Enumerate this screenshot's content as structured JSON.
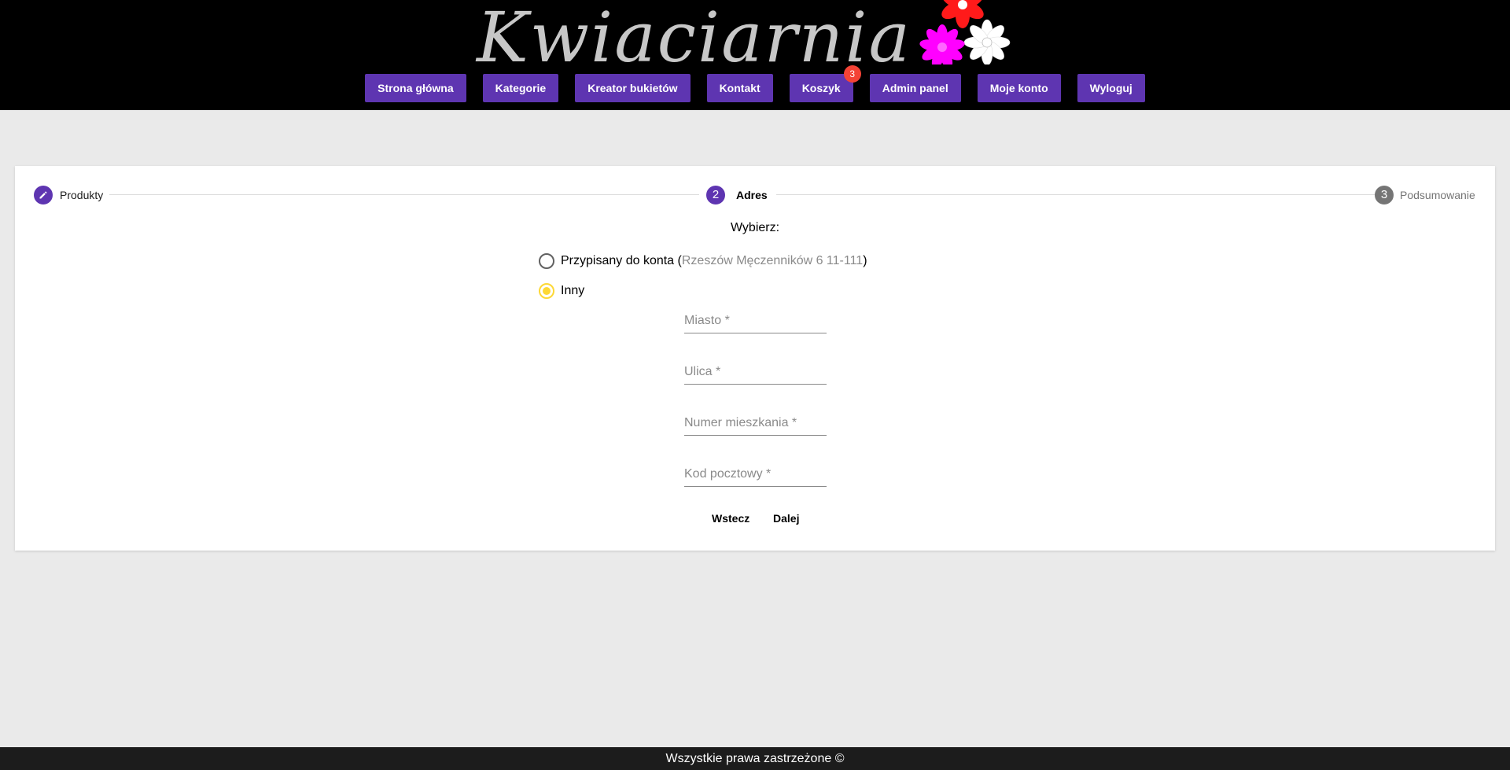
{
  "header": {
    "logo_text": "Kwiaciarnia",
    "nav": [
      {
        "label": "Strona główna"
      },
      {
        "label": "Kategorie"
      },
      {
        "label": "Kreator bukietów"
      },
      {
        "label": "Kontakt"
      },
      {
        "label": "Koszyk",
        "badge": "3"
      },
      {
        "label": "Admin panel"
      },
      {
        "label": "Moje konto"
      },
      {
        "label": "Wyloguj"
      }
    ]
  },
  "stepper": {
    "steps": [
      {
        "number": "",
        "icon": "pencil-icon",
        "label": "Produkty",
        "state": "done"
      },
      {
        "number": "2",
        "label": "Adres",
        "state": "active"
      },
      {
        "number": "3",
        "label": "Podsumowanie",
        "state": "pending"
      }
    ]
  },
  "address": {
    "choose_label": "Wybierz:",
    "option_account_label": "Przypisany do konta (",
    "option_account_address": "Rzeszów Męczenników 6 11-111",
    "option_account_close": ")",
    "option_other_label": "Inny",
    "selected": "other",
    "fields": {
      "city_placeholder": "Miasto *",
      "street_placeholder": "Ulica *",
      "flat_placeholder": "Numer mieszkania *",
      "postal_placeholder": "Kod pocztowy *"
    },
    "back_label": "Wstecz",
    "next_label": "Dalej"
  },
  "footer": {
    "text": "Wszystkie prawa zastrzeżone ©"
  },
  "colors": {
    "header_bg": "#000000",
    "nav_button": "#5e35b1",
    "badge": "#f44336",
    "step_active": "#5e35b1",
    "step_pending": "#757575",
    "radio_selected": "#fdd835",
    "page_bg": "#eaeaea",
    "footer_bg": "#1c1c1c"
  }
}
